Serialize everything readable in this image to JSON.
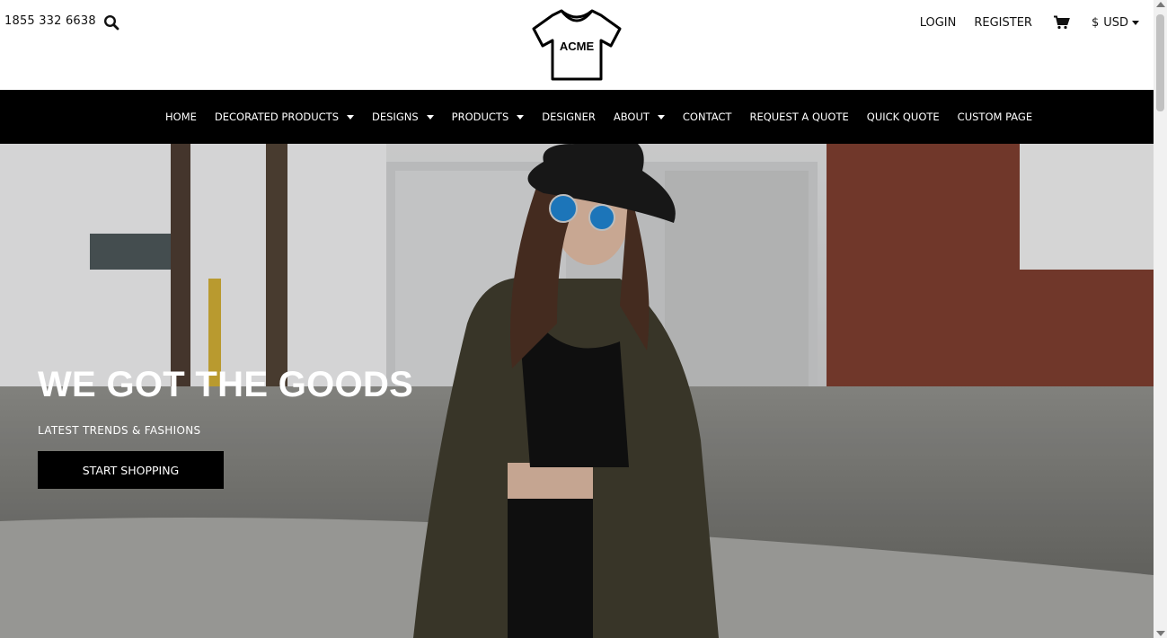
{
  "header": {
    "phone": "1855 332 6638",
    "logo_text": "ACME",
    "login_label": "LOGIN",
    "register_label": "REGISTER",
    "currency_symbol": "$",
    "currency_code": "USD"
  },
  "icons": {
    "search": "search-icon",
    "cart": "cart-icon",
    "logo": "tshirt-logo-icon"
  },
  "nav": {
    "items": [
      {
        "label": "HOME",
        "dropdown": false
      },
      {
        "label": "DECORATED PRODUCTS",
        "dropdown": true
      },
      {
        "label": "DESIGNS",
        "dropdown": true
      },
      {
        "label": "PRODUCTS",
        "dropdown": true
      },
      {
        "label": "DESIGNER",
        "dropdown": false
      },
      {
        "label": "ABOUT",
        "dropdown": true
      },
      {
        "label": "CONTACT",
        "dropdown": false
      },
      {
        "label": "REQUEST A QUOTE",
        "dropdown": false
      },
      {
        "label": "QUICK QUOTE",
        "dropdown": false
      },
      {
        "label": "CUSTOM PAGE",
        "dropdown": false
      }
    ]
  },
  "hero": {
    "title": "WE GOT THE GOODS",
    "subtitle": "LATEST TRENDS & FASHIONS",
    "cta_label": "START SHOPPING"
  },
  "colors": {
    "nav_bg": "#000000",
    "nav_text": "#ffffff",
    "cta_bg": "#000000",
    "cta_text": "#ffffff"
  }
}
